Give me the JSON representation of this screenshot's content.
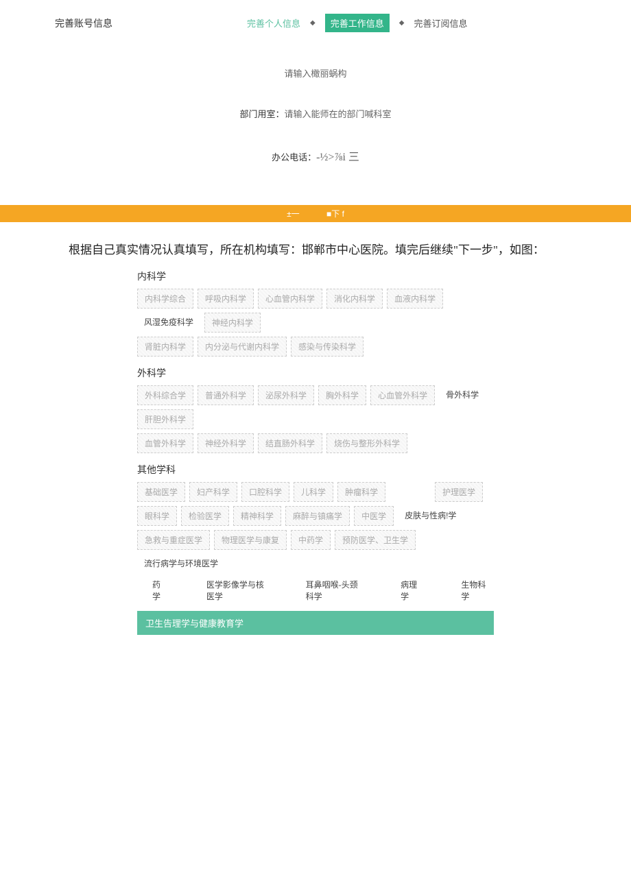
{
  "header": {
    "title": "完善账号信息",
    "steps": {
      "s1": "完善个人信息",
      "s2": "完善工作信息",
      "s3": "完善订阅信息"
    }
  },
  "form": {
    "org_placeholder": "请输入橄丽蜗构",
    "dept_label": "部门用室：",
    "dept_placeholder": "请输入能师在的部门喊科室",
    "phone_label": "办公电话：",
    "phone_value": "-½>⅞i 三"
  },
  "orange": {
    "prev": "±一",
    "next": "■下 f"
  },
  "instruction": "根据自己真实情况认真填写，所在机构填写：邯郸市中心医院。填完后继续\"下一步\"，如图：",
  "cat_internal": {
    "title": "内科学",
    "row1": {
      "t1": "内科学综合",
      "t2": "呼吸内科学",
      "t3": "心血管内科学",
      "t4": "消化内科学",
      "t5": "血液内科学",
      "t6": "风湿免疫科学",
      "t7": "神经内科学"
    },
    "row2": {
      "t1": "肾脏内科学",
      "t2": "内分泌与代谢内科学",
      "t3": "感染与传染科学"
    }
  },
  "cat_surgery": {
    "title": "外科学",
    "row1": {
      "t1": "外科综合学",
      "t2": "普通外科学",
      "t3": "泌尿外科学",
      "t4": "胸外科学",
      "t5": "心血管外科学",
      "t6": "骨外科学",
      "t7": "肝胆外科学"
    },
    "row2": {
      "t1": "血管外科学",
      "t2": "神经外科学",
      "t3": "结直肠外科学",
      "t4": "烧伤与整形外科学"
    }
  },
  "cat_other": {
    "title": "其他学科",
    "row1": {
      "t1": "基础医学",
      "t2": "妇产科学",
      "t3": "口腔科学",
      "t4": "儿科学",
      "t5": "肿瘤科学",
      "t6": "护理医学"
    },
    "row2": {
      "t1": "眼科学",
      "t2": "检验医学",
      "t3": "精神科学",
      "t4": "麻醉与镇痛学",
      "t5": "中医学",
      "t6": "皮肤与性病!学"
    },
    "row3": {
      "t1": "急救与重症医学",
      "t2": "物理医学与康复",
      "t3": "中药学",
      "t4": "预防医学、卫生学",
      "t5": "流行病学与环境医学"
    },
    "plain": {
      "t1": "药学",
      "t2": "医学影像学与核医学",
      "t3": "耳鼻咽喉-头颈科学",
      "t4": "病理学",
      "t5": "生物科学"
    }
  },
  "green_bar": "卫生告理学与健康教育学"
}
